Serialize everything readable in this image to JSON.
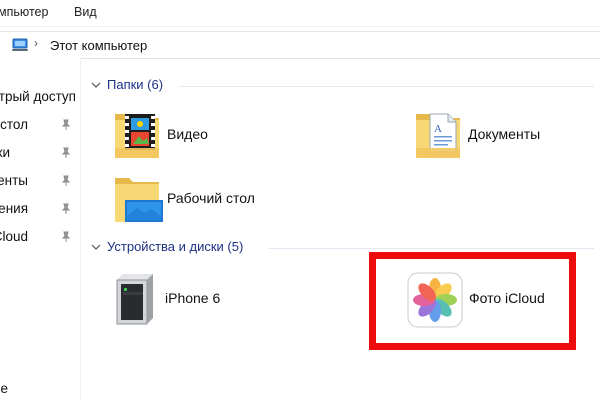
{
  "ribbon": {
    "tabs": [
      {
        "label": "мпьютер"
      },
      {
        "label": "Вид"
      }
    ]
  },
  "address": {
    "crumb": "Этот компьютер"
  },
  "nav": {
    "items": [
      {
        "label": "Быстрый доступ",
        "pinned": false
      },
      {
        "label": "Рабочий стол",
        "pinned": true
      },
      {
        "label": "Загрузки",
        "pinned": true
      },
      {
        "label": "Документы",
        "pinned": true
      },
      {
        "label": "Изображения",
        "pinned": true
      },
      {
        "label": "iCloud",
        "pinned": true
      },
      {
        "label": "e",
        "pinned": false
      }
    ]
  },
  "groups": {
    "folders": {
      "title": "Папки (6)",
      "items": [
        {
          "label": "Видео",
          "icon": "video-folder-icon"
        },
        {
          "label": "Документы",
          "icon": "documents-folder-icon"
        },
        {
          "label": "Рабочий стол",
          "icon": "desktop-folder-icon"
        }
      ]
    },
    "devices": {
      "title": "Устройства и диски (5)",
      "items": [
        {
          "label": "iPhone 6",
          "icon": "portable-device-icon"
        },
        {
          "label": "Фото iCloud",
          "icon": "icloud-photos-icon"
        }
      ]
    }
  },
  "colors": {
    "highlight": "#ee0d0d",
    "group_title": "#1e3287",
    "folder": "#f8d775"
  }
}
